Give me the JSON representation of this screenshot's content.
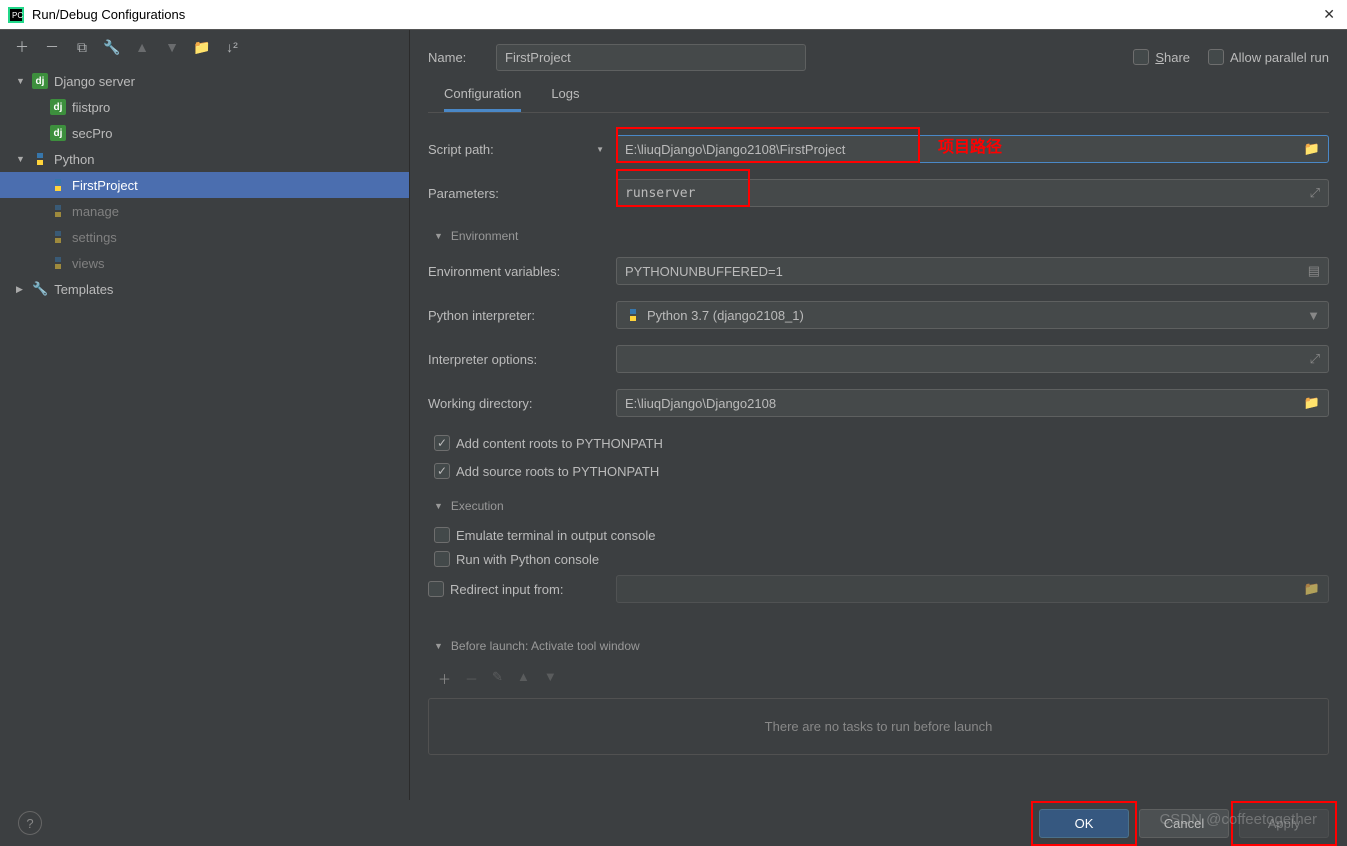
{
  "window": {
    "title": "Run/Debug Configurations"
  },
  "tree": {
    "django_server": {
      "label": "Django server",
      "children": [
        {
          "label": "fiistpro"
        },
        {
          "label": "secPro"
        }
      ]
    },
    "python": {
      "label": "Python",
      "children": [
        {
          "label": "FirstProject",
          "selected": true
        },
        {
          "label": "manage",
          "muted": true
        },
        {
          "label": "settings",
          "muted": true
        },
        {
          "label": "views",
          "muted": true
        }
      ]
    },
    "templates": {
      "label": "Templates"
    }
  },
  "form": {
    "name_label": "Name:",
    "name_value": "FirstProject",
    "share_label": "Share",
    "allow_parallel_label": "Allow parallel run",
    "tabs": {
      "configuration": "Configuration",
      "logs": "Logs"
    },
    "script_path_label": "Script path:",
    "script_path_value": "E:\\liuqDjango\\Django2108\\FirstProject",
    "parameters_label": "Parameters:",
    "parameters_value": "runserver",
    "environment_header": "Environment",
    "env_vars_label": "Environment variables:",
    "env_vars_value": "PYTHONUNBUFFERED=1",
    "interpreter_label": "Python interpreter:",
    "interpreter_value": "Python 3.7 (django2108_1)",
    "interp_options_label": "Interpreter options:",
    "interp_options_value": "",
    "working_dir_label": "Working directory:",
    "working_dir_value": "E:\\liuqDjango\\Django2108",
    "add_content_roots": "Add content roots to PYTHONPATH",
    "add_source_roots": "Add source roots to PYTHONPATH",
    "execution_header": "Execution",
    "emulate_terminal": "Emulate terminal in output console",
    "run_python_console": "Run with Python console",
    "redirect_input_label": "Redirect input from:",
    "redirect_input_value": "",
    "before_launch_header": "Before launch: Activate tool window",
    "no_tasks": "There are no tasks to run before launch"
  },
  "annotation": {
    "project_path": "项目路径"
  },
  "buttons": {
    "ok": "OK",
    "cancel": "Cancel",
    "apply": "Apply"
  },
  "watermark": "CSDN @coffeetogether"
}
